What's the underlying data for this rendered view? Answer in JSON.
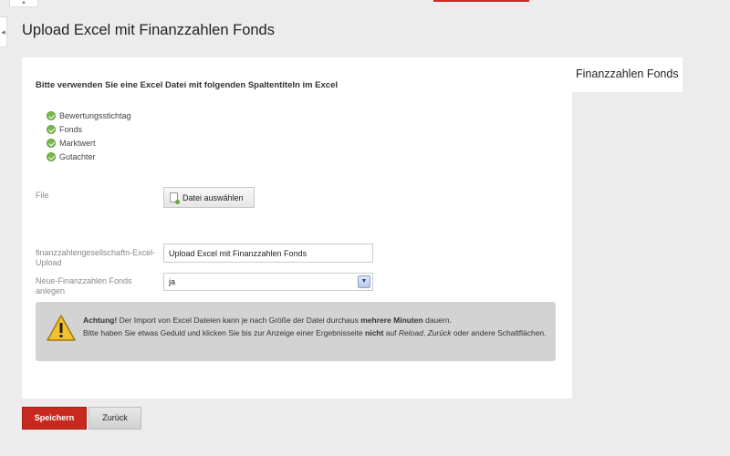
{
  "page": {
    "title": "Upload Excel mit Finanzzahlen Fonds",
    "side_tab": "Finanzzahlen Fonds"
  },
  "instructions": {
    "heading": "Bitte verwenden Sie eine Excel Datei mit folgenden Spaltentiteln im Excel",
    "columns": [
      "Bewertungsstichtag",
      "Fonds",
      "Marktwert",
      "Gutachter"
    ]
  },
  "form": {
    "file_label": "File",
    "file_button": "Datei auswählen",
    "upload_label": "finanzzahlengesellschaftn-Excel-Upload",
    "upload_value": "Upload Excel mit Finanzzahlen Fonds",
    "new_fonds_label": "Neue-Finanzzahlen Fonds anlegen",
    "new_fonds_value": "ja"
  },
  "warning": {
    "strong": "Achtung!",
    "part1": " Der Import von Excel Dateien kann je nach Größe der Datei durchaus ",
    "strong2": "mehrere Minuten",
    "part2": " dauern.",
    "part3": "Bitte haben Sie etwas Geduld und klicken Sie bis zur Anzeige einer Ergebnisseite ",
    "strong3": "nicht",
    "part4": " auf ",
    "em1": "Reload",
    "part5": ", ",
    "em2": "Zurück",
    "part6": " oder andere Schaltflächen."
  },
  "buttons": {
    "save": "Speichern",
    "back": "Zurück"
  },
  "colors": {
    "accent": "#c8281e",
    "check": "#7ab84a",
    "warning_bg": "#d3d3d3"
  },
  "icons": {
    "topmini": "arrow-icon",
    "handle": "arrow-icon"
  }
}
